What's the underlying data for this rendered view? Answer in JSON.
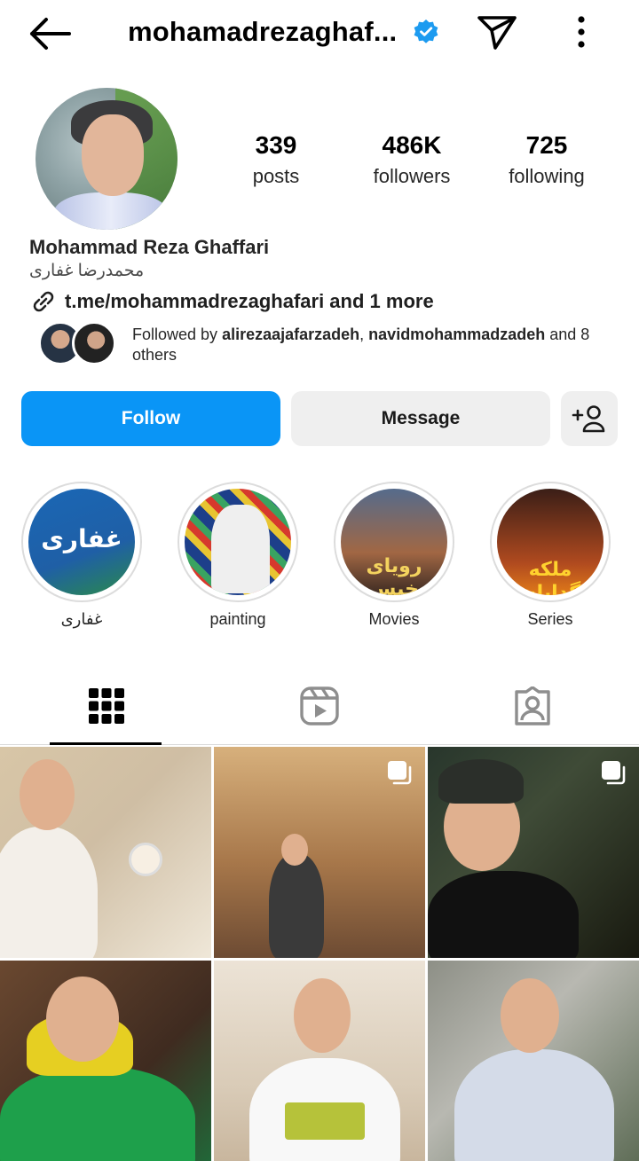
{
  "header": {
    "username": "mohamadrezaghaf...",
    "verified": true
  },
  "profile": {
    "stats": [
      {
        "value": "339",
        "label": "posts"
      },
      {
        "value": "486K",
        "label": "followers"
      },
      {
        "value": "725",
        "label": "following"
      }
    ],
    "name": "Mohammad Reza Ghaffari",
    "persian_name": "محمدرضا غفاری",
    "link_text": "t.me/mohammadrezaghafari and 1 more",
    "followed_by": {
      "prefix": "Followed by ",
      "user1": "alirezaajafarzadeh",
      "separator": ", ",
      "user2": "navidmohammadzadeh",
      "suffix": " and 8 others"
    }
  },
  "actions": {
    "follow_label": "Follow",
    "message_label": "Message"
  },
  "highlights": [
    {
      "label": "غفاری",
      "cover_text": "غفاری"
    },
    {
      "label": "painting"
    },
    {
      "label": "Movies",
      "cover_text": "رویای خیس"
    },
    {
      "label": "Series",
      "cover_text": "ملکه گدایان"
    }
  ],
  "tabs": [
    {
      "name": "grid",
      "icon": "grid-icon",
      "active": true
    },
    {
      "name": "reels",
      "icon": "reels-icon",
      "active": false
    },
    {
      "name": "tagged",
      "icon": "tagged-icon",
      "active": false
    }
  ],
  "colors": {
    "follow_button": "#0a95f6",
    "verified_badge": "#1d9bf0",
    "secondary_button": "#efefef"
  },
  "posts": [
    {
      "multi": false
    },
    {
      "multi": true
    },
    {
      "multi": true
    },
    {
      "multi": false
    },
    {
      "multi": false
    },
    {
      "multi": false
    }
  ]
}
